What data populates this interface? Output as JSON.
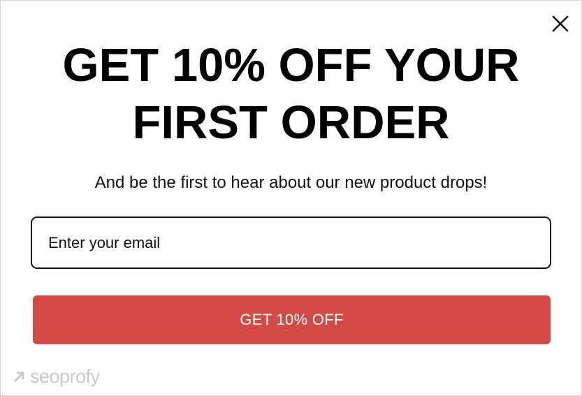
{
  "popup": {
    "headline_line1": "GET 10% OFF YOUR",
    "headline_line2": "FIRST ORDER",
    "subheadline": "And be the first to hear about our new product drops!",
    "email_placeholder": "Enter your email",
    "cta_label": "GET 10% OFF",
    "close_icon": "close-icon"
  },
  "watermark": {
    "text": "seoprofy",
    "icon": "arrow-up-right-icon"
  },
  "colors": {
    "background": "#ffffff",
    "text": "#000000",
    "cta_background": "#d44a47",
    "cta_text": "#ffffff",
    "input_border": "#111111",
    "watermark": "#c9c9c9"
  }
}
